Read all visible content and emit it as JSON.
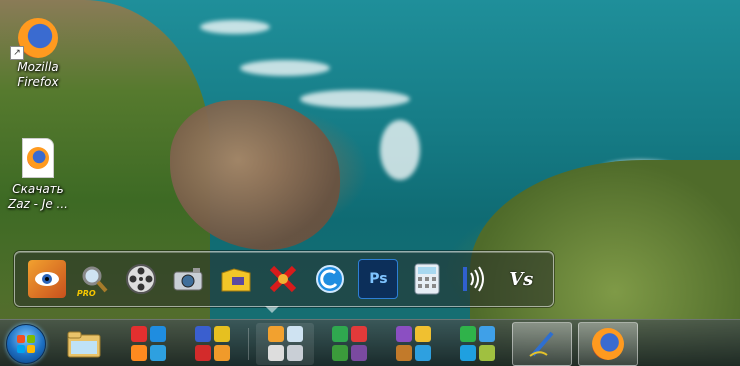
{
  "desktop_icons": [
    {
      "label_line1": "Mozilla",
      "label_line2": "Firefox"
    },
    {
      "label_line1": "Скачать",
      "label_line2": "Zaz - Je ..."
    }
  ],
  "dock": {
    "items": [
      {
        "name": "eye-app-icon",
        "glyph": "👁"
      },
      {
        "name": "magnifier-pro-icon",
        "glyph": "🔍",
        "badge": "PRO"
      },
      {
        "name": "film-reel-icon",
        "glyph": "🎞"
      },
      {
        "name": "camera-icon",
        "glyph": "📷"
      },
      {
        "name": "key-folder-icon",
        "glyph": "🔑"
      },
      {
        "name": "crossed-app-icon",
        "glyph": "✕"
      },
      {
        "name": "refresh-disc-icon",
        "glyph": "C"
      },
      {
        "name": "photoshop-icon",
        "glyph": "Ps"
      },
      {
        "name": "calculator-icon",
        "glyph": "▦"
      },
      {
        "name": "audio-wave-icon",
        "glyph": "(•)"
      },
      {
        "name": "vs-app-icon",
        "glyph": "Vs"
      }
    ]
  },
  "taskbar": {
    "colors": {
      "accent": "#1c6fc2",
      "folder": "#e9c36a",
      "firefox": "#e2501c"
    }
  }
}
